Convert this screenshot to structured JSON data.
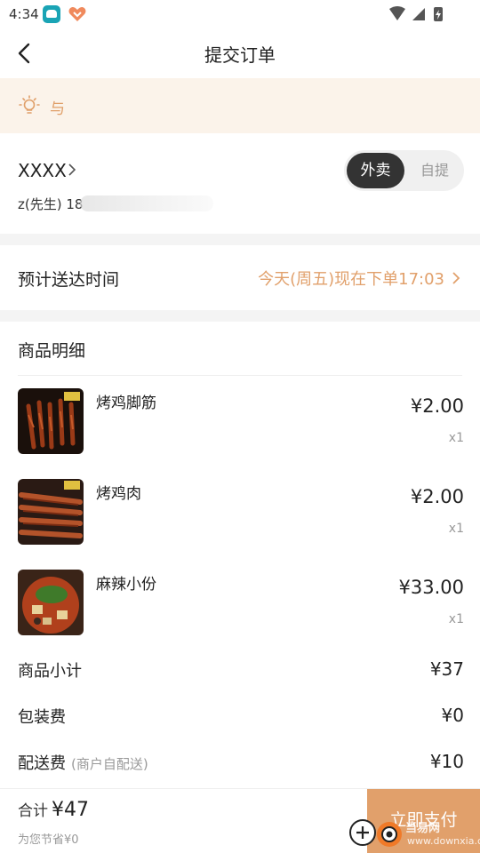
{
  "status_bar": {
    "time": "4:34"
  },
  "nav": {
    "title": "提交订单"
  },
  "notice": {
    "text": "与"
  },
  "address": {
    "place": "XXXX",
    "contact": "z(先生) 18",
    "mode_options": [
      "外卖",
      "自提"
    ],
    "selected_mode": "外卖"
  },
  "eta": {
    "label": "预计送达时间",
    "value": "今天(周五)现在下单17:03"
  },
  "detail": {
    "heading": "商品明细",
    "items": [
      {
        "name": "烤鸡脚筋",
        "price": "¥2.00",
        "qty": "x1"
      },
      {
        "name": "烤鸡肉",
        "price": "¥2.00",
        "qty": "x1"
      },
      {
        "name": "麻辣小份",
        "price": "¥33.00",
        "qty": "x1"
      }
    ],
    "fees": [
      {
        "label": "商品小计",
        "note": "",
        "value": "¥37"
      },
      {
        "label": "包装费",
        "note": "",
        "value": "¥0"
      },
      {
        "label": "配送费",
        "note": "(商户自配送)",
        "value": "¥10"
      }
    ]
  },
  "bottom": {
    "total_label": "合计",
    "total_amount": "¥47",
    "saved": "为您节省¥0",
    "pay_label": "立即支付"
  },
  "watermark": {
    "line1": "当易网",
    "line2": "www.downxia.com"
  },
  "colors": {
    "accent": "#e1a06b",
    "notice_bg": "#fbf3ea"
  }
}
